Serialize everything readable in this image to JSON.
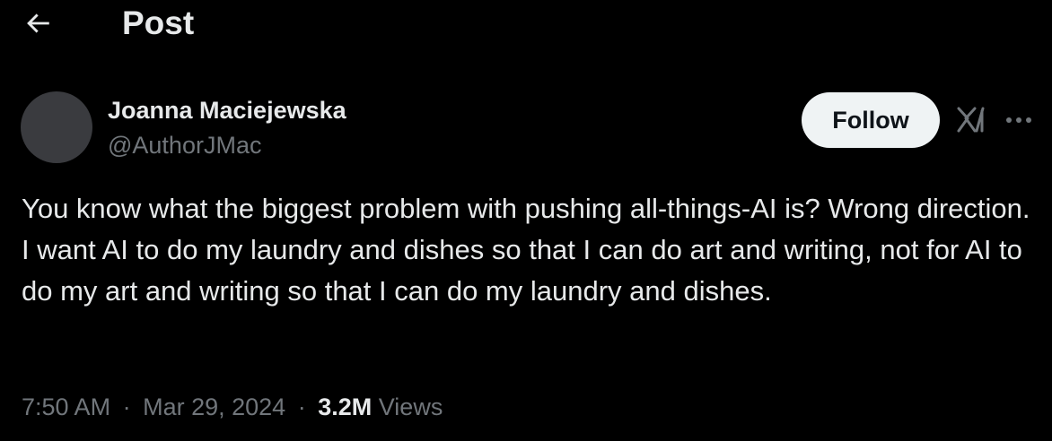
{
  "header": {
    "back_icon": "arrow-left-icon",
    "title": "Post"
  },
  "author": {
    "display_name": "Joanna Maciejewska",
    "handle": "@AuthorJMac",
    "avatar_color": "#3a3b3f"
  },
  "actions": {
    "follow_label": "Follow",
    "grok_icon": "grok-icon",
    "more_icon": "more-horizontal-icon"
  },
  "tweet": {
    "paragraph_1": "You know what the biggest problem with pushing all-things-AI is? Wrong direction.",
    "paragraph_2": "I want AI to do my laundry and dishes so that I can do art and writing, not for AI to do my art and writing so that I can do my laundry and dishes."
  },
  "meta": {
    "time": "7:50 AM",
    "separator_1": "·",
    "date": "Mar 29, 2024",
    "separator_2": "·",
    "views_count": "3.2M",
    "views_label": "Views"
  },
  "colors": {
    "background": "#000000",
    "primary_text": "#e7e9ea",
    "secondary_text": "#71767b",
    "follow_button_bg": "#eff3f4",
    "follow_button_text": "#0f1419"
  }
}
